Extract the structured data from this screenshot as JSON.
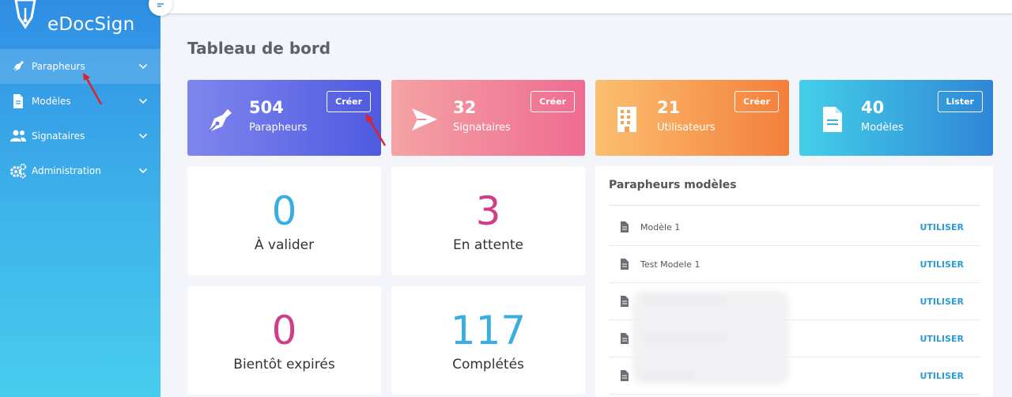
{
  "app": {
    "name": "eDocSign"
  },
  "sidebar": {
    "items": [
      {
        "label": "Parapheurs",
        "icon": "pen-nib-icon"
      },
      {
        "label": "Modèles",
        "icon": "file-icon"
      },
      {
        "label": "Signataires",
        "icon": "users-icon"
      },
      {
        "label": "Administration",
        "icon": "cogs-icon"
      }
    ]
  },
  "page": {
    "title": "Tableau de bord"
  },
  "stats": [
    {
      "value": "504",
      "label": "Parapheurs",
      "button": "Créer",
      "icon": "pen-nib-icon"
    },
    {
      "value": "32",
      "label": "Signataires",
      "button": "Créer",
      "icon": "paper-plane-icon"
    },
    {
      "value": "21",
      "label": "Utilisateurs",
      "button": "Créer",
      "icon": "building-icon"
    },
    {
      "value": "40",
      "label": "Modèles",
      "button": "Lister",
      "icon": "file-icon"
    }
  ],
  "counts": [
    {
      "value": "0",
      "label": "À valider",
      "color": "#3aaee3"
    },
    {
      "value": "3",
      "label": "En attente",
      "color": "#cf3e86"
    },
    {
      "value": "0",
      "label": "Bientôt expirés",
      "color": "#cf3e86"
    },
    {
      "value": "117",
      "label": "Complétés",
      "color": "#3aaee3"
    }
  ],
  "templates": {
    "title": "Parapheurs modèles",
    "action_label": "UTILISER",
    "rows": [
      {
        "name": "Modèle 1"
      },
      {
        "name": "Test Modele 1"
      },
      {
        "name": ""
      },
      {
        "name": ""
      },
      {
        "name": ""
      }
    ]
  }
}
